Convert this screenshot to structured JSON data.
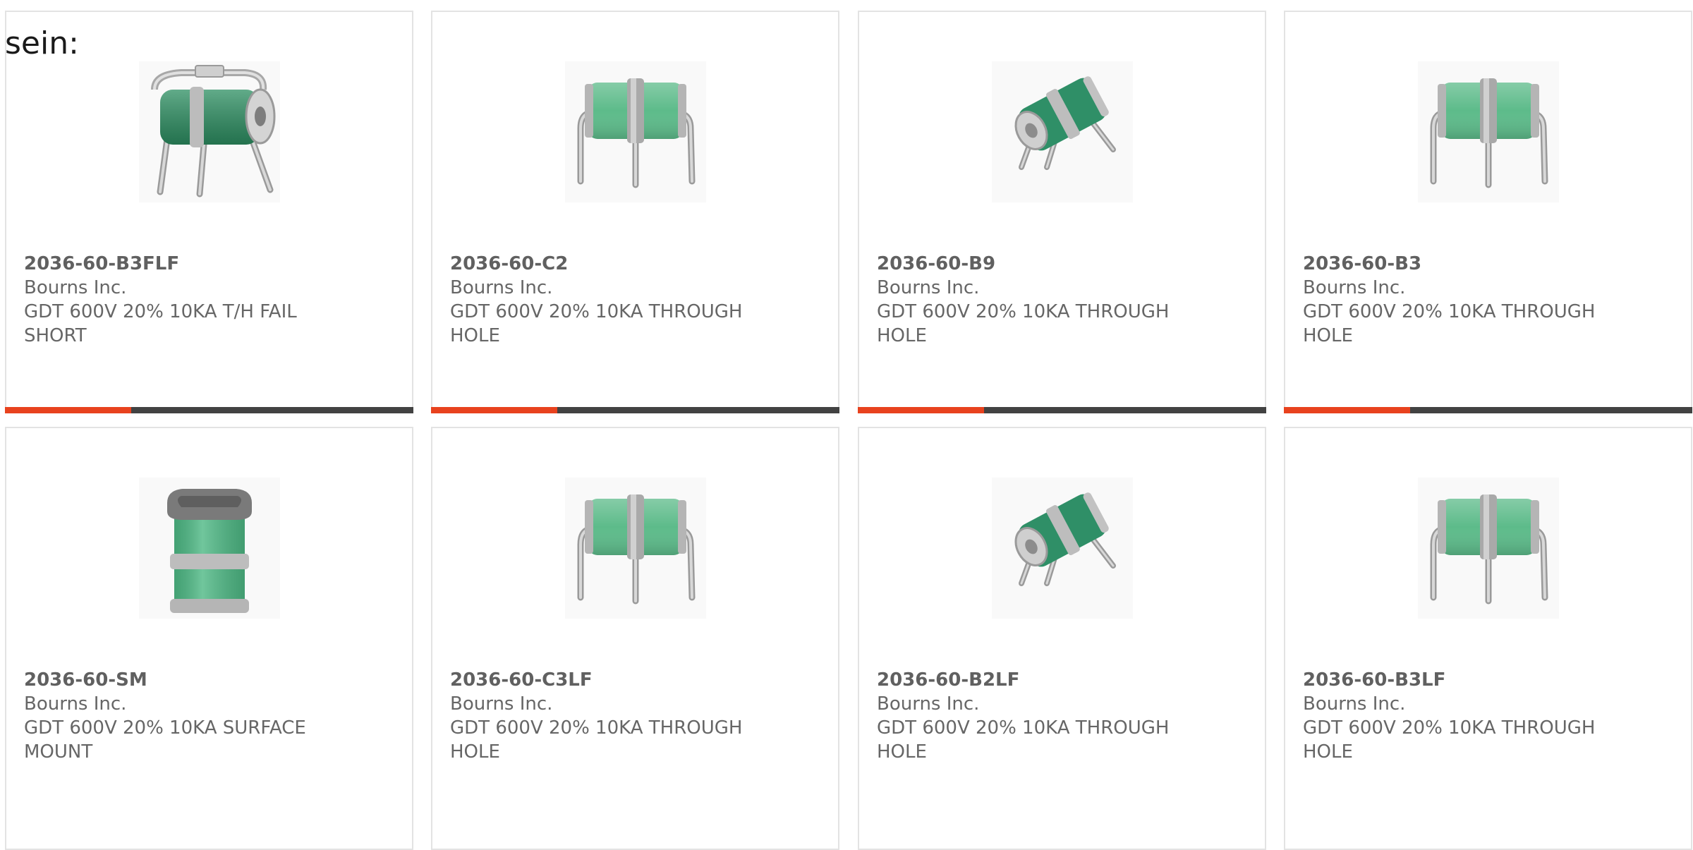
{
  "lead_text": "sein:",
  "colors": {
    "card_border": "#e3e3e3",
    "accent": "#e8421e",
    "bar_dark": "#424242",
    "text": "#666666"
  },
  "rows": [
    [
      {
        "part": "2036-60-B3FLF",
        "maker": "Bourns Inc.",
        "desc": "GDT 600V 20% 10KA T/H FAIL SHORT",
        "image": "gdt-3lead-fail-short-icon",
        "progress": 0.31
      },
      {
        "part": "2036-60-C2",
        "maker": "Bourns Inc.",
        "desc": "GDT 600V 20% 10KA THROUGH HOLE",
        "image": "gdt-3lead-front-icon",
        "progress": 0.31
      },
      {
        "part": "2036-60-B9",
        "maker": "Bourns Inc.",
        "desc": "GDT 600V 20% 10KA THROUGH HOLE",
        "image": "gdt-3lead-angled-icon",
        "progress": 0.31
      },
      {
        "part": "2036-60-B3",
        "maker": "Bourns Inc.",
        "desc": "GDT 600V 20% 10KA THROUGH HOLE",
        "image": "gdt-3lead-front-icon",
        "progress": 0.31
      }
    ],
    [
      {
        "part": "2036-60-SM",
        "maker": "Bourns Inc.",
        "desc": "GDT 600V 20% 10KA SURFACE MOUNT",
        "image": "gdt-surface-mount-icon"
      },
      {
        "part": "2036-60-C3LF",
        "maker": "Bourns Inc.",
        "desc": "GDT 600V 20% 10KA THROUGH HOLE",
        "image": "gdt-3lead-front-icon"
      },
      {
        "part": "2036-60-B2LF",
        "maker": "Bourns Inc.",
        "desc": "GDT 600V 20% 10KA THROUGH HOLE",
        "image": "gdt-3lead-angled-icon"
      },
      {
        "part": "2036-60-B3LF",
        "maker": "Bourns Inc.",
        "desc": "GDT 600V 20% 10KA THROUGH HOLE",
        "image": "gdt-3lead-front-icon"
      }
    ]
  ]
}
